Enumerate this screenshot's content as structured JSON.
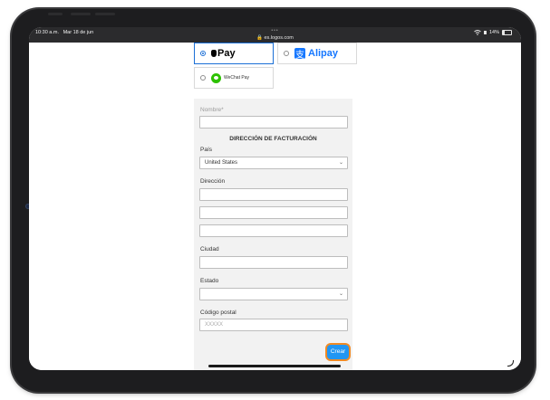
{
  "status_bar": {
    "time": "10:30 a.m.",
    "date": "Mar 18 de jun",
    "dots": "•••",
    "url": "🔒 es.logos.com",
    "wifi_icon": "wifi-icon",
    "battery": "14%"
  },
  "payment": {
    "applepay": "Pay",
    "alipay": "Alipay",
    "wechat": "WeChat Pay"
  },
  "form": {
    "name_label": "Nombre*",
    "billing_heading": "DIRECCIÓN DE FACTURACIÓN",
    "country_label": "País",
    "country_value": "United States",
    "address_label": "Dirección",
    "city_label": "Ciudad",
    "state_label": "Estado",
    "zip_label": "Código postal",
    "zip_placeholder": "XXXXX",
    "submit_label": "Crear"
  },
  "colors": {
    "accent": "#2196f3",
    "highlight": "#f08a24",
    "alipay_blue": "#1677ff",
    "wechat_green": "#2dc100"
  }
}
